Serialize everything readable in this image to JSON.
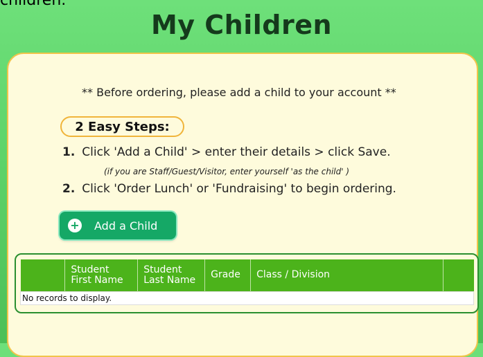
{
  "header": {
    "cut_text": "children.",
    "title": "My Children"
  },
  "notice": "** Before ordering, please add a child to your account **",
  "steps": {
    "badge": "2 Easy Steps:",
    "items": [
      {
        "num": "1.",
        "text": "Click 'Add a Child' > enter their details > click Save."
      },
      {
        "num": "2.",
        "text": "Click 'Order Lunch' or 'Fundraising' to begin ordering."
      }
    ],
    "note": "(if you are Staff/Guest/Visitor, enter yourself 'as the child' )"
  },
  "add_button": {
    "icon": "plus-circle-icon",
    "label": "Add a Child"
  },
  "table": {
    "columns": [
      "",
      "Student First Name",
      "Student Last Name",
      "Grade",
      "Class / Division",
      ""
    ],
    "empty_text": "No records to display."
  },
  "colors": {
    "background_green": "#5ed46a",
    "panel": "#fefbdc",
    "panel_border": "#f1c44a",
    "button": "#15a866",
    "table_header": "#4cb31b",
    "grid_border": "#2a8f2f"
  }
}
